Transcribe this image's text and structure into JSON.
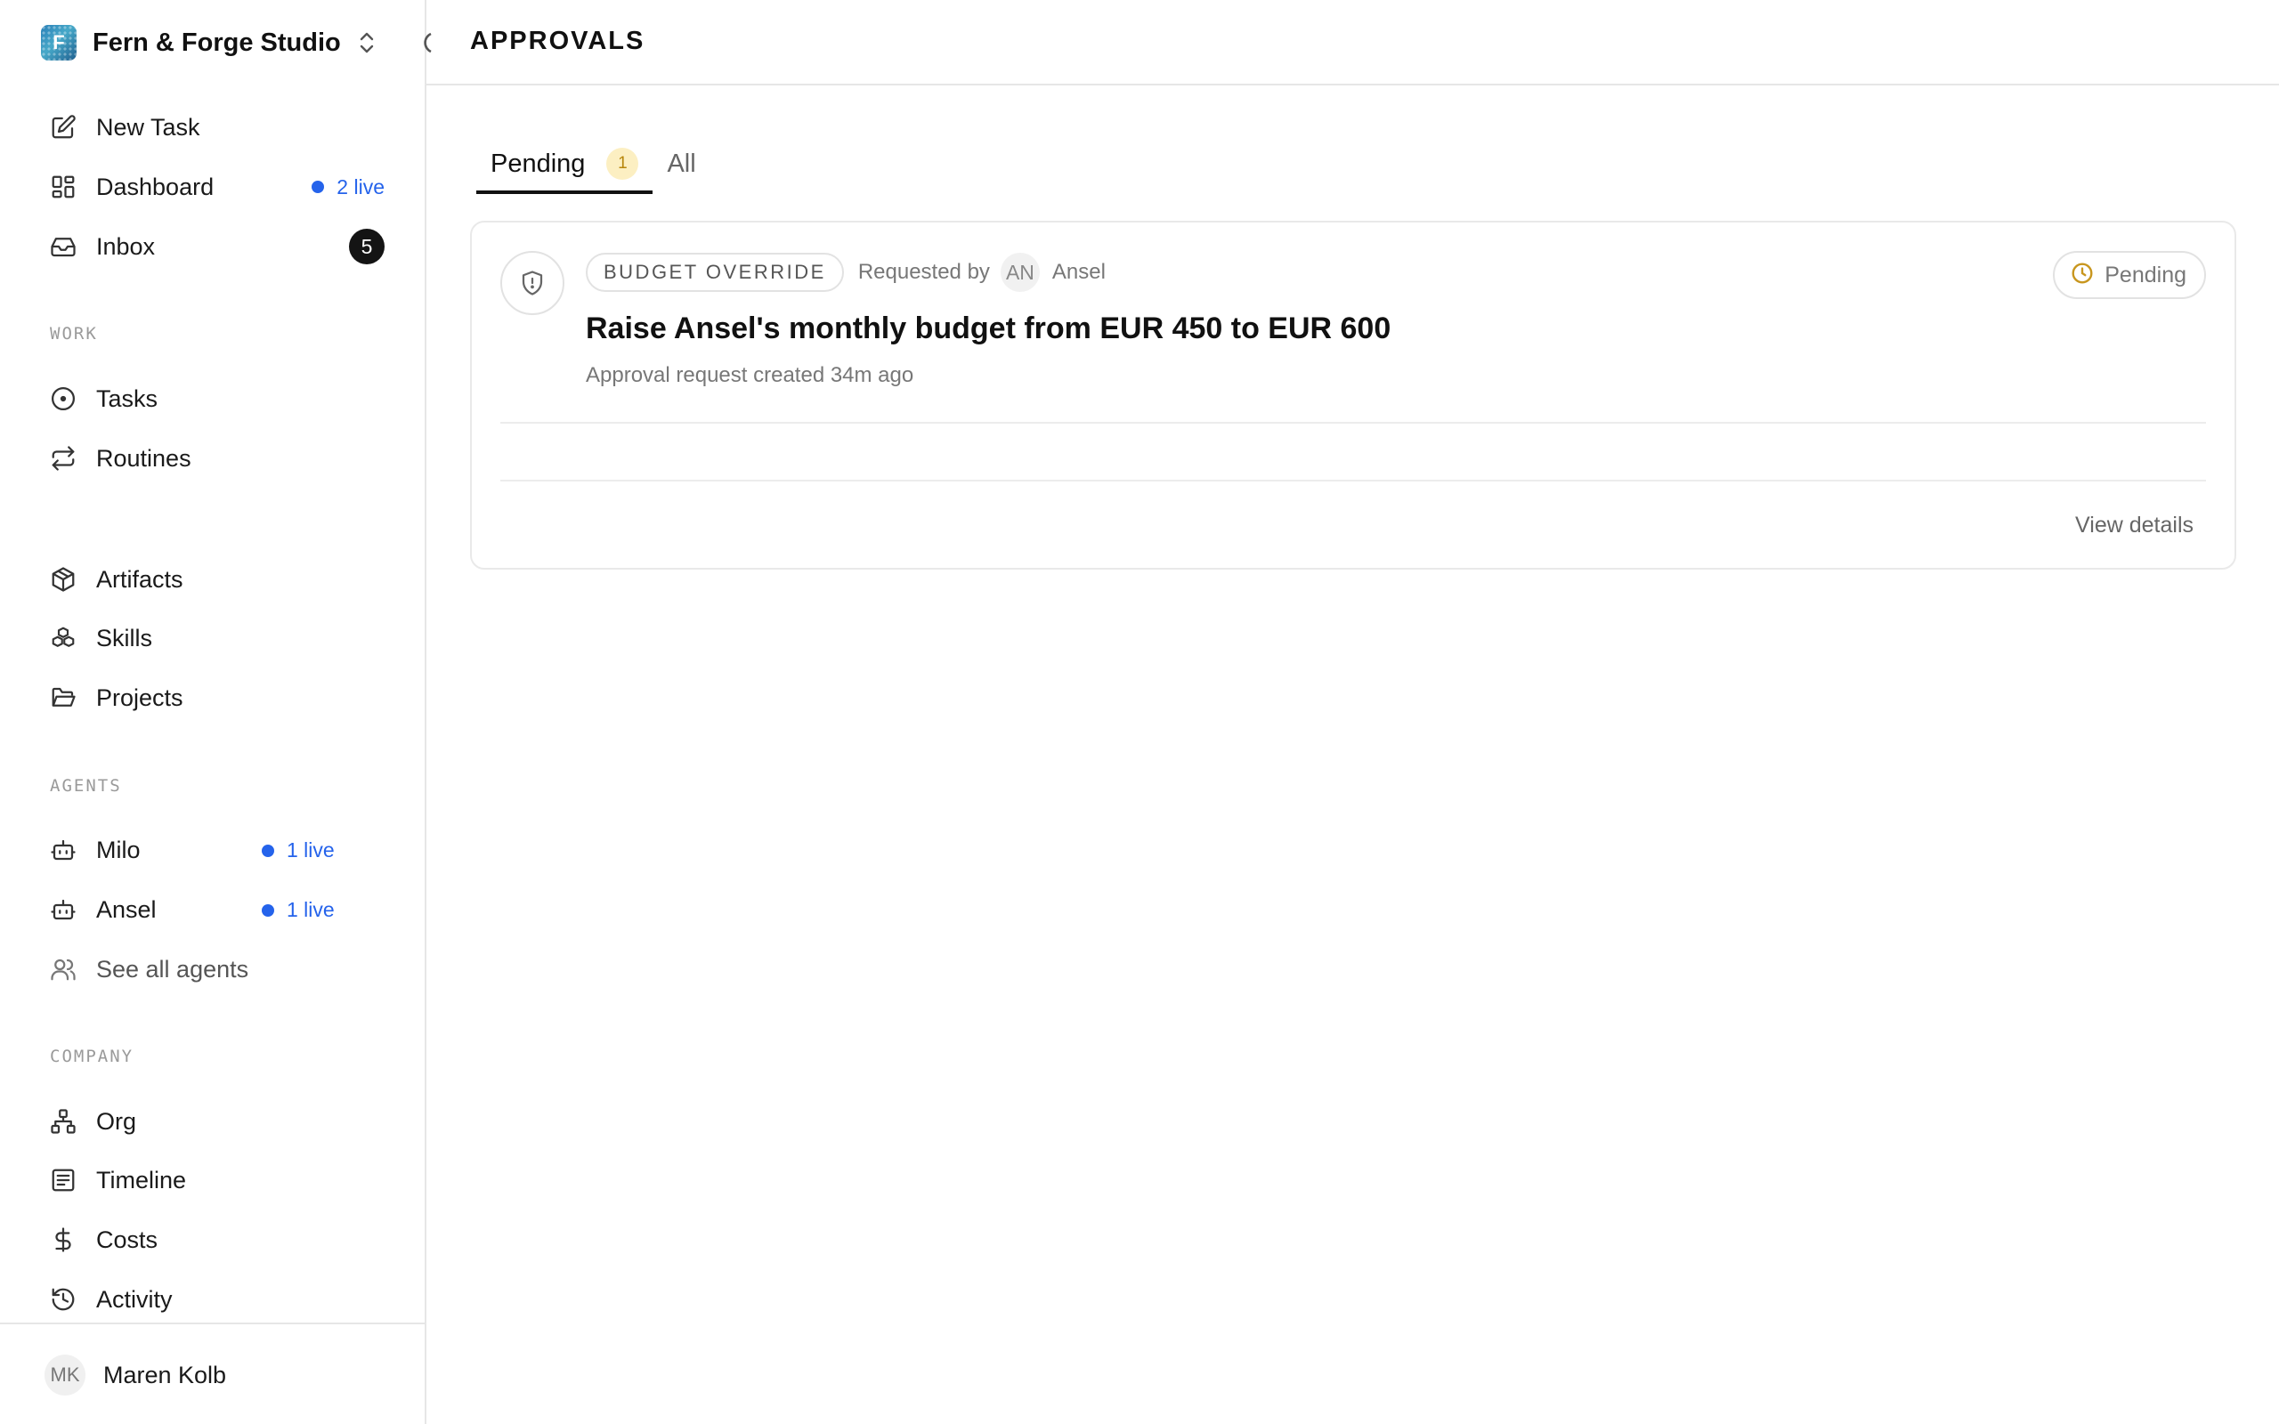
{
  "company": {
    "name": "Fern & Forge Studio",
    "logo_letter": "F"
  },
  "nav": {
    "new_task": "New Task",
    "dashboard": {
      "label": "Dashboard",
      "live": "2 live"
    },
    "inbox": {
      "label": "Inbox",
      "count": "5"
    }
  },
  "sections": {
    "work": "WORK",
    "agents": "AGENTS",
    "company": "COMPANY"
  },
  "work_items": {
    "tasks": "Tasks",
    "routines": "Routines"
  },
  "library_items": {
    "artifacts": "Artifacts",
    "skills": "Skills",
    "projects": "Projects"
  },
  "agents": [
    {
      "name": "Milo",
      "live": "1 live"
    },
    {
      "name": "Ansel",
      "live": "1 live"
    }
  ],
  "see_all_agents": "See all agents",
  "company_items": {
    "org": "Org",
    "timeline": "Timeline",
    "costs": "Costs",
    "activity": "Activity"
  },
  "user": {
    "initials": "MK",
    "name": "Maren Kolb"
  },
  "page": {
    "title": "APPROVALS"
  },
  "tabs": {
    "pending": "Pending",
    "pending_count": "1",
    "all": "All"
  },
  "approval": {
    "type": "BUDGET OVERRIDE",
    "requested_by_label": "Requested by",
    "requester_initials": "AN",
    "requester_name": "Ansel",
    "status": "Pending",
    "title": "Raise Ansel's monthly budget from EUR 450 to EUR 600",
    "subtitle": "Approval request created 34m ago",
    "view_details": "View details"
  },
  "colors": {
    "live": "#2563eb",
    "pending_accent": "#c8961e",
    "pending_badge_bg": "#fcefc2"
  }
}
